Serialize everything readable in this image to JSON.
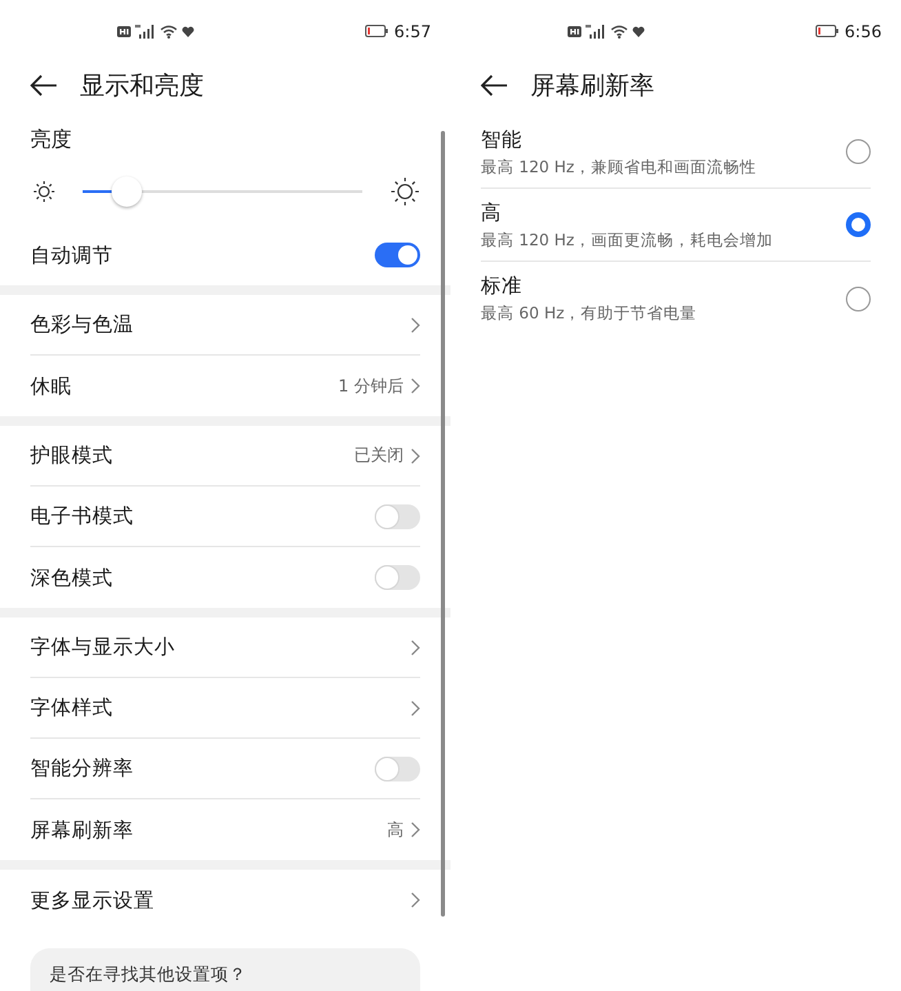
{
  "left_screen": {
    "status_bar": {
      "time": "6:57"
    },
    "title": "显示和亮度",
    "brightness": {
      "label": "亮度",
      "level": 0.16
    },
    "sections": [
      [
        {
          "kind": "toggle",
          "label": "自动调节",
          "on": true
        }
      ],
      [
        {
          "kind": "link",
          "label": "色彩与色温"
        },
        {
          "kind": "link",
          "label": "休眠",
          "value": "1 分钟后"
        }
      ],
      [
        {
          "kind": "link",
          "label": "护眼模式",
          "value": "已关闭"
        },
        {
          "kind": "toggle",
          "label": "电子书模式",
          "on": false
        },
        {
          "kind": "toggle",
          "label": "深色模式",
          "on": false
        }
      ],
      [
        {
          "kind": "link",
          "label": "字体与显示大小"
        },
        {
          "kind": "link",
          "label": "字体样式"
        },
        {
          "kind": "toggle",
          "label": "智能分辨率",
          "on": false
        },
        {
          "kind": "link",
          "label": "屏幕刷新率",
          "value": "高"
        }
      ],
      [
        {
          "kind": "link",
          "label": "更多显示设置"
        }
      ]
    ],
    "suggestion_card": {
      "text": "是否在寻找其他设置项？"
    }
  },
  "right_screen": {
    "status_bar": {
      "time": "6:56"
    },
    "title": "屏幕刷新率",
    "options": [
      {
        "title": "智能",
        "subtitle": "最高 120 Hz，兼顾省电和画面流畅性",
        "selected": false
      },
      {
        "title": "高",
        "subtitle": "最高 120 Hz，画面更流畅，耗电会增加",
        "selected": true
      },
      {
        "title": "标准",
        "subtitle": "最高 60 Hz，有助于节省电量",
        "selected": false
      }
    ]
  }
}
